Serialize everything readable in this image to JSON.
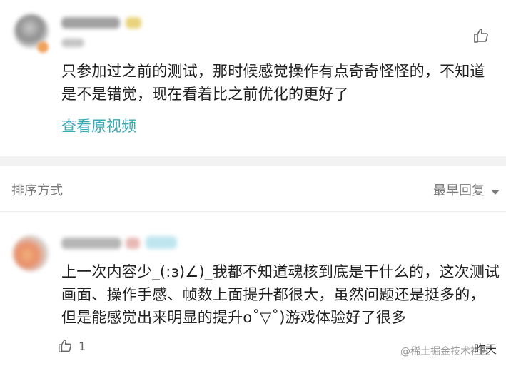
{
  "comment1": {
    "text_line1": "只参加过之前的测试，那时候感觉操作有点奇奇怪怪的，不知道",
    "text_line2": "是不是错觉，现在看着比之前优化的更好了",
    "view_original": "查看原视频"
  },
  "sort_bar": {
    "label": "排序方式",
    "selected": "最早回复"
  },
  "comment2": {
    "text_line1": "上一次内容少_(:з)∠)_我都不知道魂核到底是干什么的，这次测试",
    "text_line2": "画面、操作手感、帧数上面提升都很大，虽然问题还是挺多的，",
    "text_line3": "但是能感觉出来明显的提升o˚▽˚)游戏体验好了很多",
    "like_count": "1",
    "time": "昨天"
  },
  "watermark": "@稀土掘金技术社区",
  "colors": {
    "link": "#3aa8b5",
    "divider": "#f2f2f2",
    "muted": "#7a7a7a"
  }
}
